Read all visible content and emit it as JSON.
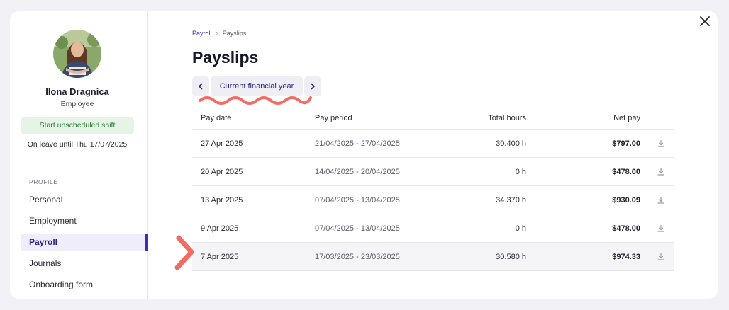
{
  "employee": {
    "name": "Ilona Dragnica",
    "role": "Employee",
    "shift_button": "Start unscheduled shift",
    "leave_status": "On leave until Thu 17/07/2025"
  },
  "sidebar": {
    "section_label": "PROFILE",
    "items": [
      {
        "label": "Personal"
      },
      {
        "label": "Employment"
      },
      {
        "label": "Payroll"
      },
      {
        "label": "Journals"
      },
      {
        "label": "Onboarding form"
      }
    ],
    "active_item": "Payroll"
  },
  "breadcrumb": {
    "parent": "Payroll",
    "separator": ">",
    "current": "Payslips"
  },
  "page_title": "Payslips",
  "period_picker": {
    "label": "Current financial year",
    "prev_icon": "chevron-left-icon",
    "next_icon": "chevron-right-icon"
  },
  "table": {
    "headers": {
      "pay_date": "Pay date",
      "pay_period": "Pay period",
      "total_hours": "Total hours",
      "net_pay": "Net pay"
    },
    "rows": [
      {
        "pay_date": "27 Apr 2025",
        "pay_period": "21/04/2025 - 27/04/2025",
        "total_hours": "30.400 h",
        "net_pay": "$797.00"
      },
      {
        "pay_date": "20 Apr 2025",
        "pay_period": "14/04/2025 - 20/04/2025",
        "total_hours": "0 h",
        "net_pay": "$478.00"
      },
      {
        "pay_date": "13 Apr 2025",
        "pay_period": "07/04/2025 - 13/04/2025",
        "total_hours": "34.370 h",
        "net_pay": "$930.09"
      },
      {
        "pay_date": "9 Apr 2025",
        "pay_period": "07/04/2025 - 13/04/2025",
        "total_hours": "0 h",
        "net_pay": "$478.00"
      },
      {
        "pay_date": "7 Apr 2025",
        "pay_period": "17/03/2025 - 23/03/2025",
        "total_hours": "30.580 h",
        "net_pay": "$974.33"
      }
    ],
    "highlighted_row": "7 Apr 2025",
    "row_action_icon": "download-icon"
  },
  "colors": {
    "accent": "#3b2fb8",
    "annotation": "#f26b64",
    "success_bg": "#e6f4e7",
    "success_text": "#2f7a35"
  }
}
